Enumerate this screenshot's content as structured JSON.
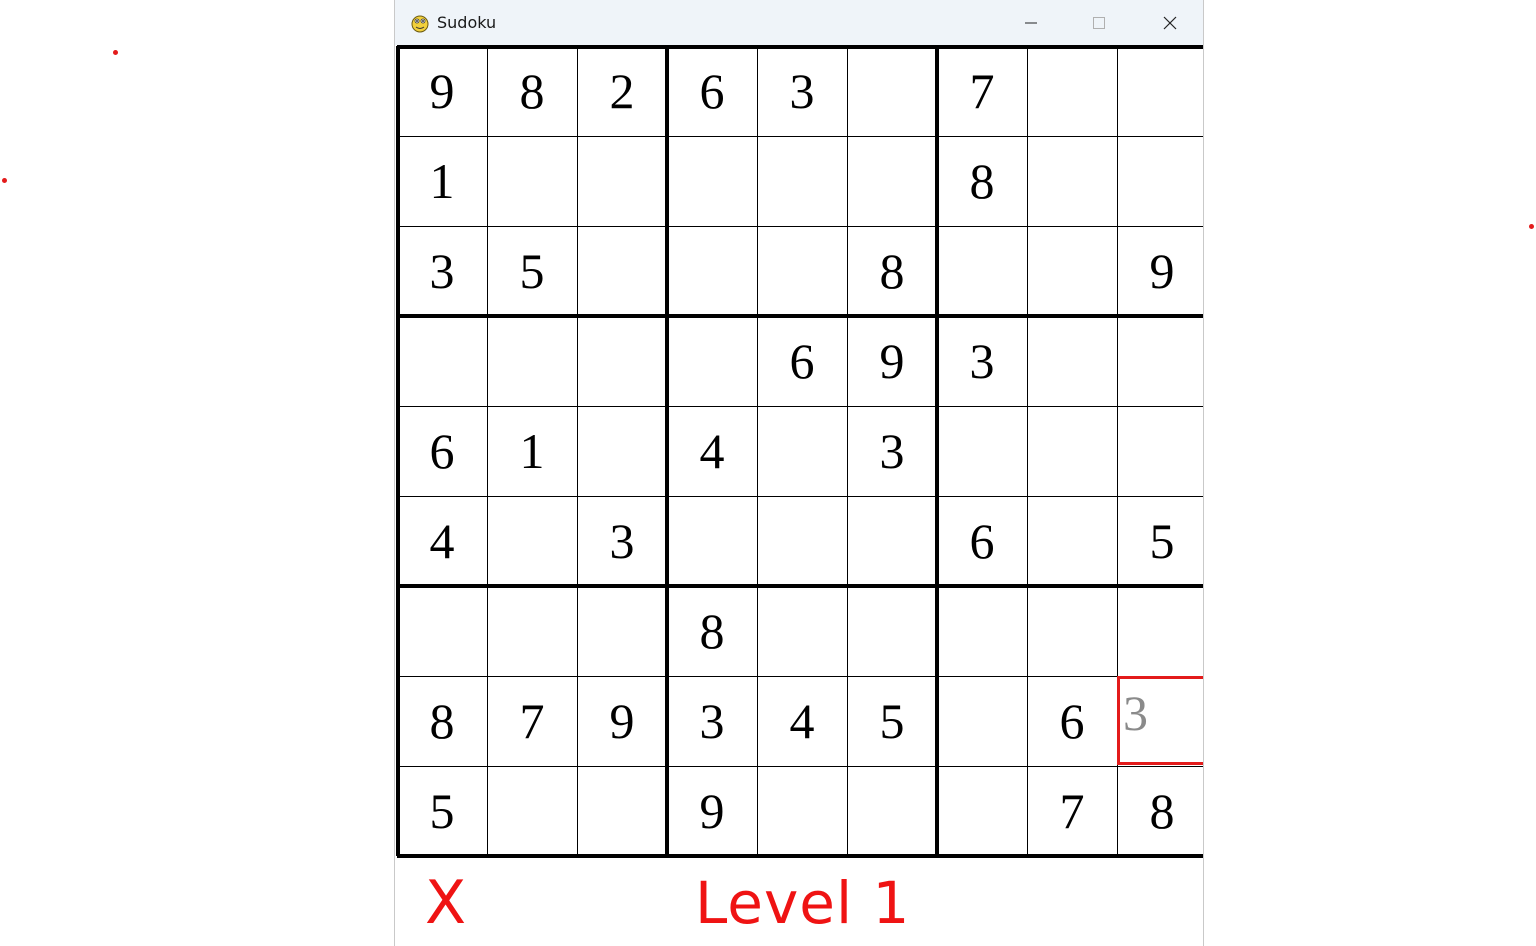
{
  "window": {
    "title": "Sudoku",
    "app_icon": "python-snake-icon",
    "controls": [
      "minimize-icon",
      "maximize-icon",
      "close-icon"
    ]
  },
  "board": {
    "rows": [
      [
        "9",
        "8",
        "2",
        "6",
        "3",
        "",
        "7",
        "",
        ""
      ],
      [
        "1",
        "",
        "",
        "",
        "",
        "",
        "8",
        "",
        ""
      ],
      [
        "3",
        "5",
        "",
        "",
        "",
        "8",
        "",
        "",
        "9"
      ],
      [
        "",
        "",
        "",
        "",
        "6",
        "9",
        "3",
        "",
        ""
      ],
      [
        "6",
        "1",
        "",
        "4",
        "",
        "3",
        "",
        "",
        ""
      ],
      [
        "4",
        "",
        "3",
        "",
        "",
        "",
        "6",
        "",
        "5"
      ],
      [
        "",
        "",
        "",
        "8",
        "",
        "",
        "",
        "",
        ""
      ],
      [
        "8",
        "7",
        "9",
        "3",
        "4",
        "5",
        "",
        "6",
        ""
      ],
      [
        "5",
        "",
        "",
        "9",
        "",
        "",
        "",
        "7",
        "8"
      ]
    ],
    "selected_cell": {
      "row": 7,
      "col": 8
    },
    "draft_value": "3",
    "colors": {
      "given_digit": "#000000",
      "draft_digit": "#8a8a8a",
      "selection": "#e31b1b"
    }
  },
  "footer": {
    "strikes": "X",
    "level": "Level 1",
    "color": "#ef1313"
  }
}
